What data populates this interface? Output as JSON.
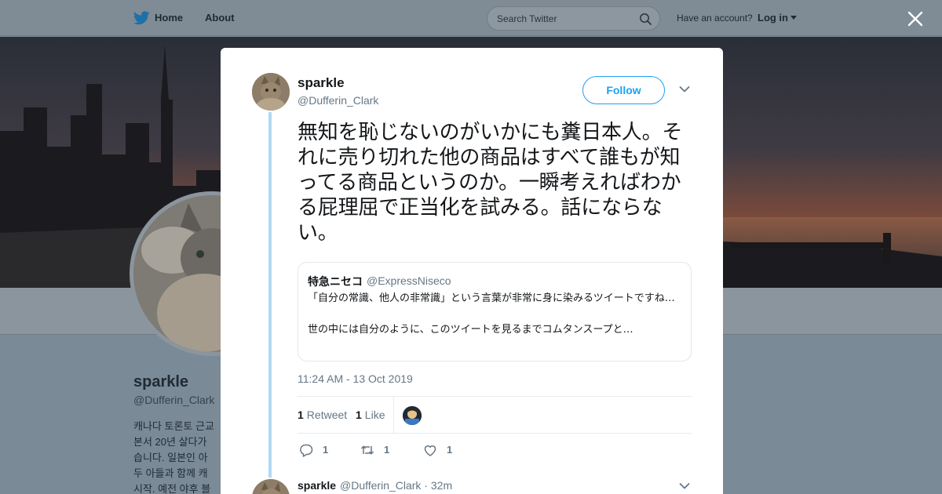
{
  "nav": {
    "home": "Home",
    "about": "About",
    "search_placeholder": "Search Twitter",
    "account_question": "Have an account?",
    "login": "Log in"
  },
  "background_profile": {
    "name": "sparkle",
    "handle": "@Dufferin_Clark",
    "bio": "캐나다 토론토 근교\n본서 20년 살다가\n습니다. 일본인 아\n두 아들과 함께 캐\n시작. 예전 야후 블"
  },
  "tweet": {
    "author_name": "sparkle",
    "author_handle": "@Dufferin_Clark",
    "follow_label": "Follow",
    "text": "無知を恥じないのがいかにも糞日本人。それに売り切れた他の商品はすべて誰もが知ってる商品というのか。一瞬考えればわかる屁理屈で正当化を試みる。話にならない。",
    "quote": {
      "name": "特急ニセコ",
      "handle": "@ExpressNiseco",
      "text": "「自分の常識、他人の非常識」という言葉が非常に身に染みるツイートですね…\n\n世の中には自分のように、このツイートを見るまでコムタンスープと…"
    },
    "timestamp": "11:24 AM - 13 Oct 2019",
    "retweets_count": "1",
    "retweets_label": "Retweet",
    "likes_count": "1",
    "likes_label": "Like",
    "reply_count": "1",
    "retweet_action_count": "1",
    "like_action_count": "1"
  },
  "next_tweet": {
    "author_name": "sparkle",
    "author_meta": "@Dufferin_Clark · 32m"
  },
  "colors": {
    "accent": "#1da1f2",
    "thread_line": "#b0d9f4",
    "secondary_text": "#657786"
  }
}
